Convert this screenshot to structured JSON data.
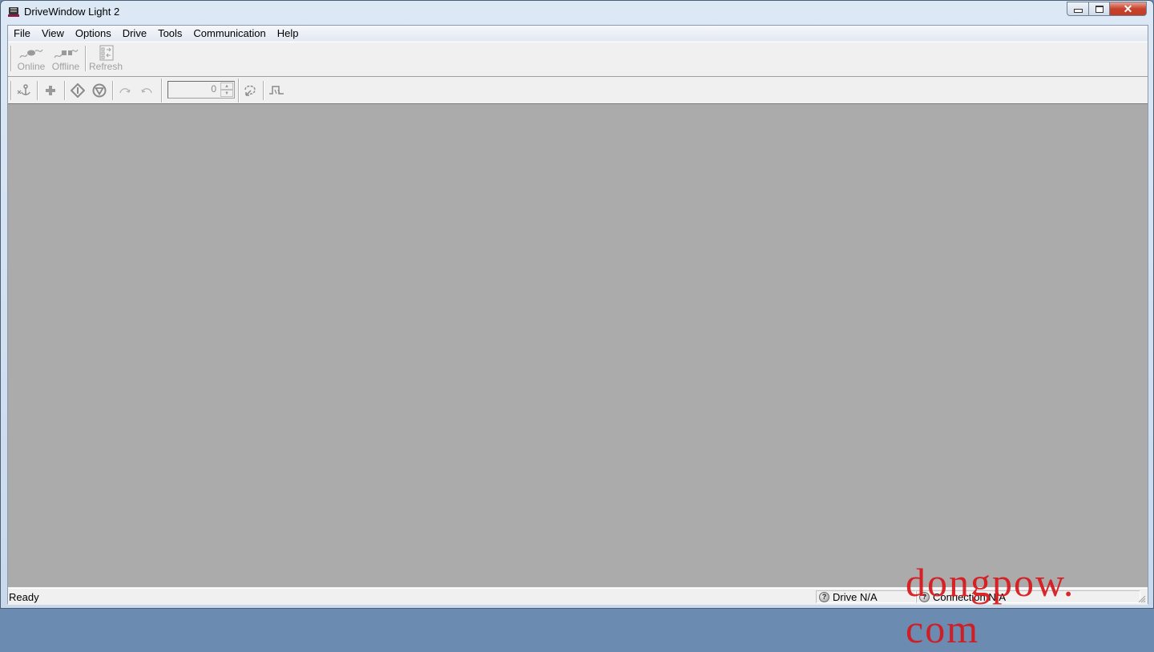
{
  "window": {
    "title": "DriveWindow Light 2",
    "icon": "drivewindow-app-icon",
    "controls": {
      "minimize": "minimize-icon",
      "maximize": "maximize-icon",
      "close": "close-icon"
    }
  },
  "menubar": {
    "items": [
      {
        "label": "File"
      },
      {
        "label": "View"
      },
      {
        "label": "Options"
      },
      {
        "label": "Drive"
      },
      {
        "label": "Tools"
      },
      {
        "label": "Communication"
      },
      {
        "label": "Help"
      }
    ]
  },
  "toolbar1": {
    "online_label": "Online",
    "offline_label": "Offline",
    "refresh_label": "Refresh"
  },
  "toolbar2": {
    "icons": [
      "anchor-icon",
      "plus-icon",
      "start-icon",
      "stop-icon",
      "redo-icon",
      "undo-icon",
      "refresh-cycle-icon",
      "step-signal-icon"
    ],
    "spin_value": "0"
  },
  "statusbar": {
    "status_text": "Ready",
    "drive_text": "Drive N/A",
    "connection_text": "Connection N/A",
    "unknown_icon": "?"
  },
  "watermark": {
    "text": "dongpow. com",
    "color": "#d8161b"
  }
}
